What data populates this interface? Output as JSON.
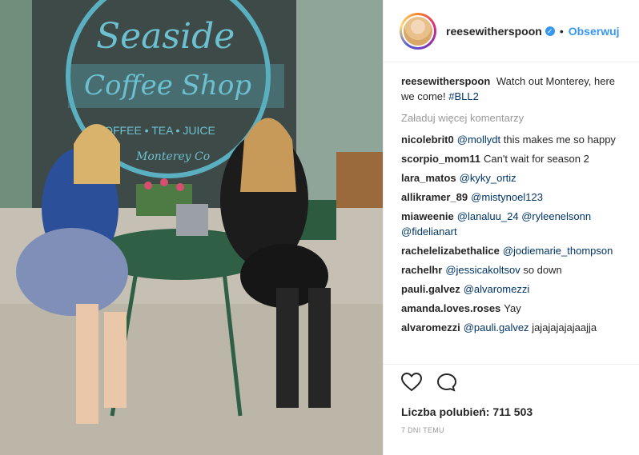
{
  "header": {
    "username": "reesewitherspoon",
    "follow_label": "Obserwuj",
    "separator": "•"
  },
  "photo": {
    "sign_line1": "Seaside",
    "sign_line2": "Coffee Shop",
    "sign_line3": "COFFEE • TEA • JUICE",
    "sign_line4": "Monterey Co"
  },
  "caption": {
    "username": "reesewitherspoon",
    "text": "Watch out Monterey, here we come!",
    "hashtag": "#BLL2"
  },
  "load_more": "Załaduj więcej komentarzy",
  "comments": [
    {
      "user": "nicolebrit0",
      "mention": "@mollydt",
      "text": "this makes me so happy"
    },
    {
      "user": "scorpio_mom11",
      "mention": "",
      "text": "Can't wait for season 2"
    },
    {
      "user": "lara_matos",
      "mention": "@kyky_ortiz",
      "text": ""
    },
    {
      "user": "allikramer_89",
      "mention": "@mistynoel123",
      "text": ""
    },
    {
      "user": "miaweenie",
      "mention": "@lanaluu_24 @ryleenelsonn @fidelianart",
      "text": ""
    },
    {
      "user": "rachelelizabethalice",
      "mention": "@jodiemarie_thompson",
      "text": ""
    },
    {
      "user": "rachelhr",
      "mention": "@jessicakoltsov",
      "text": "so down"
    },
    {
      "user": "pauli.galvez",
      "mention": "@alvaromezzi",
      "text": ""
    },
    {
      "user": "amanda.loves.roses",
      "mention": "",
      "text": "Yay"
    },
    {
      "user": "alvaromezzi",
      "mention": "@pauli.galvez",
      "text": "jajajajajajaajja"
    }
  ],
  "likes": "Liczba polubień: 711 503",
  "time": "7 DNI TEMU"
}
